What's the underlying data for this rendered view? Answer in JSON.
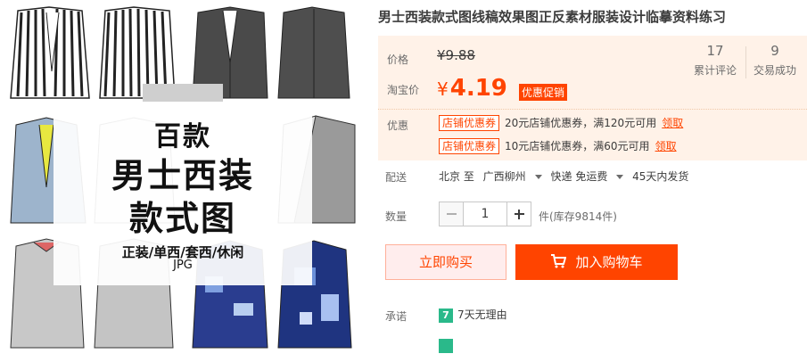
{
  "product": {
    "title": "男士西装款式图线稿效果图正反素材服装设计临摹资料练习"
  },
  "gallery": {
    "cover_line1": "百款",
    "cover_line2": "男士西装",
    "cover_line3": "款式图",
    "cover_line4": "正装/单西/套西/休闲",
    "cover_line5": "JPG"
  },
  "price": {
    "label": "价格",
    "original": "¥9.88",
    "taobao_label": "淘宝价",
    "currency": "¥",
    "promo_value": "4.19",
    "promo_badge": "优惠促销"
  },
  "stats": {
    "reviews_count": "17",
    "reviews_label": "累计评论",
    "deals_count": "9",
    "deals_label": "交易成功"
  },
  "coupons": {
    "label": "优惠",
    "items": [
      {
        "tag": "店铺优惠券",
        "text": "20元店铺优惠券，满120元可用",
        "action": "领取"
      },
      {
        "tag": "店铺优惠券",
        "text": "10元店铺优惠券，满60元可用",
        "action": "领取"
      }
    ]
  },
  "delivery": {
    "label": "配送",
    "from": "北京 至",
    "to": "广西柳州",
    "method": "快递 免运费",
    "ship_time": "45天内发货"
  },
  "quantity": {
    "label": "数量",
    "value": "1",
    "stock": "件(库存9814件)"
  },
  "actions": {
    "buy_now": "立即购买",
    "add_to_cart": "加入购物车"
  },
  "promise": {
    "label": "承诺",
    "icon_text": "7",
    "text": "7天无理由"
  },
  "colors": {
    "accent": "#ff4400",
    "price_bg": "#fff2e8",
    "promise_green": "#2ab98a"
  }
}
